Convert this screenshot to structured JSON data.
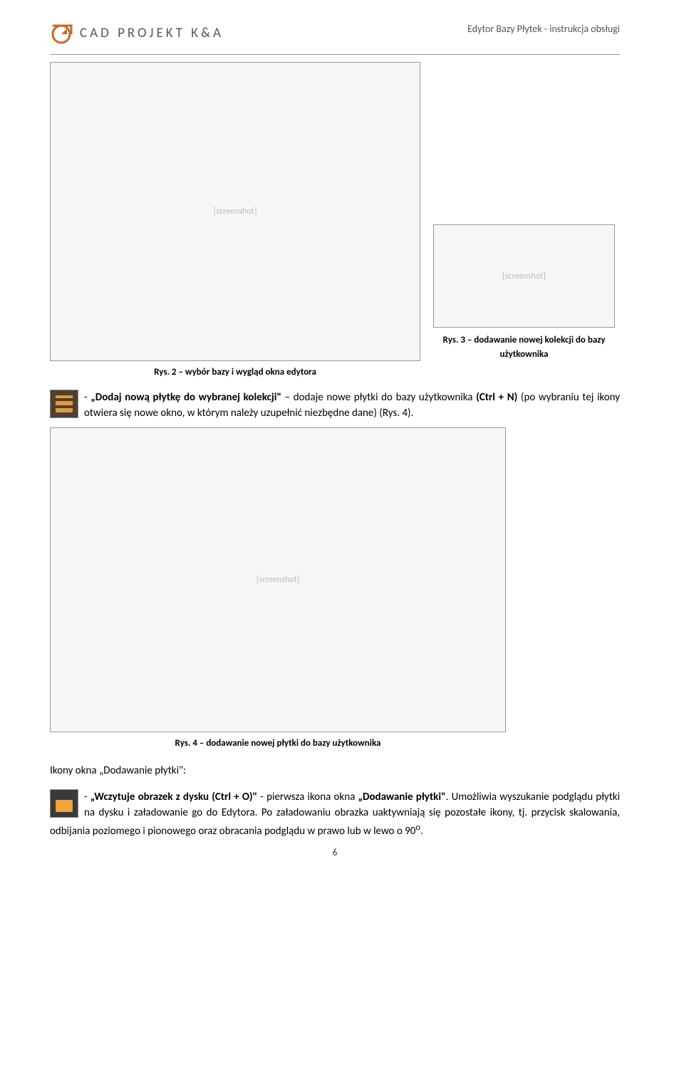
{
  "header": {
    "brand": "CAD PROJEKT K&A",
    "docTitle": "Edytor Bazy Płytek  -  instrukcja obsługi"
  },
  "figs": {
    "fig3_caption": "Rys. 3 – dodawanie nowej kolekcji do bazy użytkownika",
    "fig2_caption": "Rys. 2 – wybór bazy i wygląd okna edytora",
    "fig4_caption": "Rys. 4 – dodawanie nowej płytki do bazy użytkownika"
  },
  "body": {
    "p1_prefix": "- ",
    "p1_cmd": "„Dodaj nową płytkę do wybranej kolekcji\"",
    "p1_mid": " – dodaje nowe płytki do bazy użytkownika ",
    "p1_hotkey": "(Ctrl + N)",
    "p1_rest": " (po wybraniu tej ikony otwiera się nowe okno, w którym należy uzupełnić niezbędne dane) (Rys. 4).",
    "section": "Ikony okna „Dodawanie płytki\":",
    "p2_prefix": "- ",
    "p2_cmd": "„Wczytuje obrazek z dysku (Ctrl + O)\"",
    "p2_mid": " - pierwsza ikona okna ",
    "p2_win": "„Dodawanie płytki\"",
    "p2_rest1": ". Umożliwia wyszukanie podglądu płytki na dysku i załadowanie go do Edytora. Po załadowaniu obrazka uaktywniają się pozostałe ikony, tj. przycisk skalowania, odbijania poziomego i pionowego oraz obracania podglądu w prawo lub w lewo o 90",
    "p2_deg": "o",
    "p2_period": "."
  },
  "pagenum": "6"
}
